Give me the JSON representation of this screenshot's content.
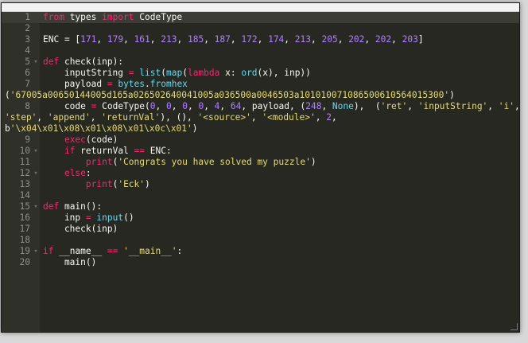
{
  "editor": {
    "lines": [
      {
        "n": "1",
        "fold": "",
        "tokens": [
          [
            "kw",
            "from"
          ],
          [
            "plain",
            " types "
          ],
          [
            "kw",
            "import"
          ],
          [
            "plain",
            " CodeType"
          ]
        ]
      },
      {
        "n": "2",
        "fold": "",
        "tokens": []
      },
      {
        "n": "3",
        "fold": "",
        "tokens": [
          [
            "plain",
            "ENC = ["
          ],
          [
            "num",
            "171"
          ],
          [
            "plain",
            ", "
          ],
          [
            "num",
            "179"
          ],
          [
            "plain",
            ", "
          ],
          [
            "num",
            "161"
          ],
          [
            "plain",
            ", "
          ],
          [
            "num",
            "213"
          ],
          [
            "plain",
            ", "
          ],
          [
            "num",
            "185"
          ],
          [
            "plain",
            ", "
          ],
          [
            "num",
            "187"
          ],
          [
            "plain",
            ", "
          ],
          [
            "num",
            "172"
          ],
          [
            "plain",
            ", "
          ],
          [
            "num",
            "174"
          ],
          [
            "plain",
            ", "
          ],
          [
            "num",
            "213"
          ],
          [
            "plain",
            ", "
          ],
          [
            "num",
            "205"
          ],
          [
            "plain",
            ", "
          ],
          [
            "num",
            "202"
          ],
          [
            "plain",
            ", "
          ],
          [
            "num",
            "202"
          ],
          [
            "plain",
            ", "
          ],
          [
            "num",
            "203"
          ],
          [
            "plain",
            "]"
          ]
        ]
      },
      {
        "n": "4",
        "fold": "",
        "tokens": []
      },
      {
        "n": "5",
        "fold": "▾",
        "tokens": [
          [
            "kw",
            "def"
          ],
          [
            "plain",
            " check(inp):"
          ]
        ]
      },
      {
        "n": "6",
        "fold": "",
        "tokens": [
          [
            "plain",
            "    inputString "
          ],
          [
            "op",
            "="
          ],
          [
            "plain",
            " "
          ],
          [
            "bi",
            "list"
          ],
          [
            "plain",
            "("
          ],
          [
            "bi",
            "map"
          ],
          [
            "plain",
            "("
          ],
          [
            "kw",
            "lambda"
          ],
          [
            "plain",
            " x: "
          ],
          [
            "bi",
            "ord"
          ],
          [
            "plain",
            "(x), inp))"
          ]
        ]
      },
      {
        "n": "7",
        "fold": "",
        "tokens": [
          [
            "plain",
            "    payload "
          ],
          [
            "op",
            "="
          ],
          [
            "plain",
            " "
          ],
          [
            "bi",
            "bytes"
          ],
          [
            "plain",
            "."
          ],
          [
            "bi",
            "fromhex"
          ]
        ],
        "wrap": [
          [
            "plain",
            "("
          ],
          [
            "str",
            "'67005a00650144005d165a026502640041005a036500a0046503a101010071086500610564015300'"
          ],
          [
            "plain",
            ")"
          ]
        ]
      },
      {
        "n": "8",
        "fold": "",
        "tokens": [
          [
            "plain",
            "    code "
          ],
          [
            "op",
            "="
          ],
          [
            "plain",
            " CodeType("
          ],
          [
            "num",
            "0"
          ],
          [
            "plain",
            ", "
          ],
          [
            "num",
            "0"
          ],
          [
            "plain",
            ", "
          ],
          [
            "num",
            "0"
          ],
          [
            "plain",
            ", "
          ],
          [
            "num",
            "0"
          ],
          [
            "plain",
            ", "
          ],
          [
            "num",
            "4"
          ],
          [
            "plain",
            ", "
          ],
          [
            "num",
            "64"
          ],
          [
            "plain",
            ", payload, ("
          ],
          [
            "num",
            "248"
          ],
          [
            "plain",
            ", "
          ],
          [
            "bi",
            "None"
          ],
          [
            "plain",
            "),  ("
          ],
          [
            "str",
            "'ret'"
          ],
          [
            "plain",
            ", "
          ],
          [
            "str",
            "'inputString'"
          ],
          [
            "plain",
            ", "
          ],
          [
            "str",
            "'i'"
          ],
          [
            "plain",
            ","
          ]
        ],
        "wrap": [
          [
            "str",
            "'step'"
          ],
          [
            "plain",
            ", "
          ],
          [
            "str",
            "'append'"
          ],
          [
            "plain",
            ", "
          ],
          [
            "str",
            "'returnVal'"
          ],
          [
            "plain",
            "), (), "
          ],
          [
            "str",
            "'<source>'"
          ],
          [
            "plain",
            ", "
          ],
          [
            "str",
            "'<module>'"
          ],
          [
            "plain",
            ", "
          ],
          [
            "num",
            "2"
          ],
          [
            "plain",
            ","
          ]
        ],
        "wrap2": [
          [
            "plain",
            "b"
          ],
          [
            "str",
            "'\\x04\\x01\\x08\\x01\\x08\\x01\\x0c\\x01'"
          ],
          [
            "plain",
            ")"
          ]
        ]
      },
      {
        "n": "9",
        "fold": "",
        "tokens": [
          [
            "plain",
            "    "
          ],
          [
            "kw",
            "exec"
          ],
          [
            "plain",
            "(code)"
          ]
        ]
      },
      {
        "n": "10",
        "fold": "▾",
        "tokens": [
          [
            "plain",
            "    "
          ],
          [
            "kw",
            "if"
          ],
          [
            "plain",
            " returnVal "
          ],
          [
            "op",
            "=="
          ],
          [
            "plain",
            " ENC:"
          ]
        ]
      },
      {
        "n": "11",
        "fold": "",
        "tokens": [
          [
            "plain",
            "        "
          ],
          [
            "kw",
            "print"
          ],
          [
            "plain",
            "("
          ],
          [
            "str",
            "'Congrats you have solved my puzzle'"
          ],
          [
            "plain",
            ")"
          ]
        ]
      },
      {
        "n": "12",
        "fold": "▾",
        "tokens": [
          [
            "plain",
            "    "
          ],
          [
            "kw",
            "else"
          ],
          [
            "plain",
            ":"
          ]
        ]
      },
      {
        "n": "13",
        "fold": "",
        "tokens": [
          [
            "plain",
            "        "
          ],
          [
            "kw",
            "print"
          ],
          [
            "plain",
            "("
          ],
          [
            "str",
            "'Eck'"
          ],
          [
            "plain",
            ")"
          ]
        ]
      },
      {
        "n": "14",
        "fold": "",
        "tokens": []
      },
      {
        "n": "15",
        "fold": "▾",
        "tokens": [
          [
            "kw",
            "def"
          ],
          [
            "plain",
            " main():"
          ]
        ]
      },
      {
        "n": "16",
        "fold": "",
        "tokens": [
          [
            "plain",
            "    inp "
          ],
          [
            "op",
            "="
          ],
          [
            "plain",
            " "
          ],
          [
            "bi",
            "input"
          ],
          [
            "plain",
            "()"
          ]
        ]
      },
      {
        "n": "17",
        "fold": "",
        "tokens": [
          [
            "plain",
            "    check(inp)"
          ]
        ]
      },
      {
        "n": "18",
        "fold": "",
        "tokens": []
      },
      {
        "n": "19",
        "fold": "▾",
        "tokens": [
          [
            "kw",
            "if"
          ],
          [
            "plain",
            " __name__ "
          ],
          [
            "op",
            "=="
          ],
          [
            "plain",
            " "
          ],
          [
            "str",
            "'__main__'"
          ],
          [
            "plain",
            ":"
          ]
        ]
      },
      {
        "n": "20",
        "fold": "",
        "tokens": [
          [
            "plain",
            "    main()"
          ]
        ]
      }
    ],
    "active_line": "1"
  }
}
